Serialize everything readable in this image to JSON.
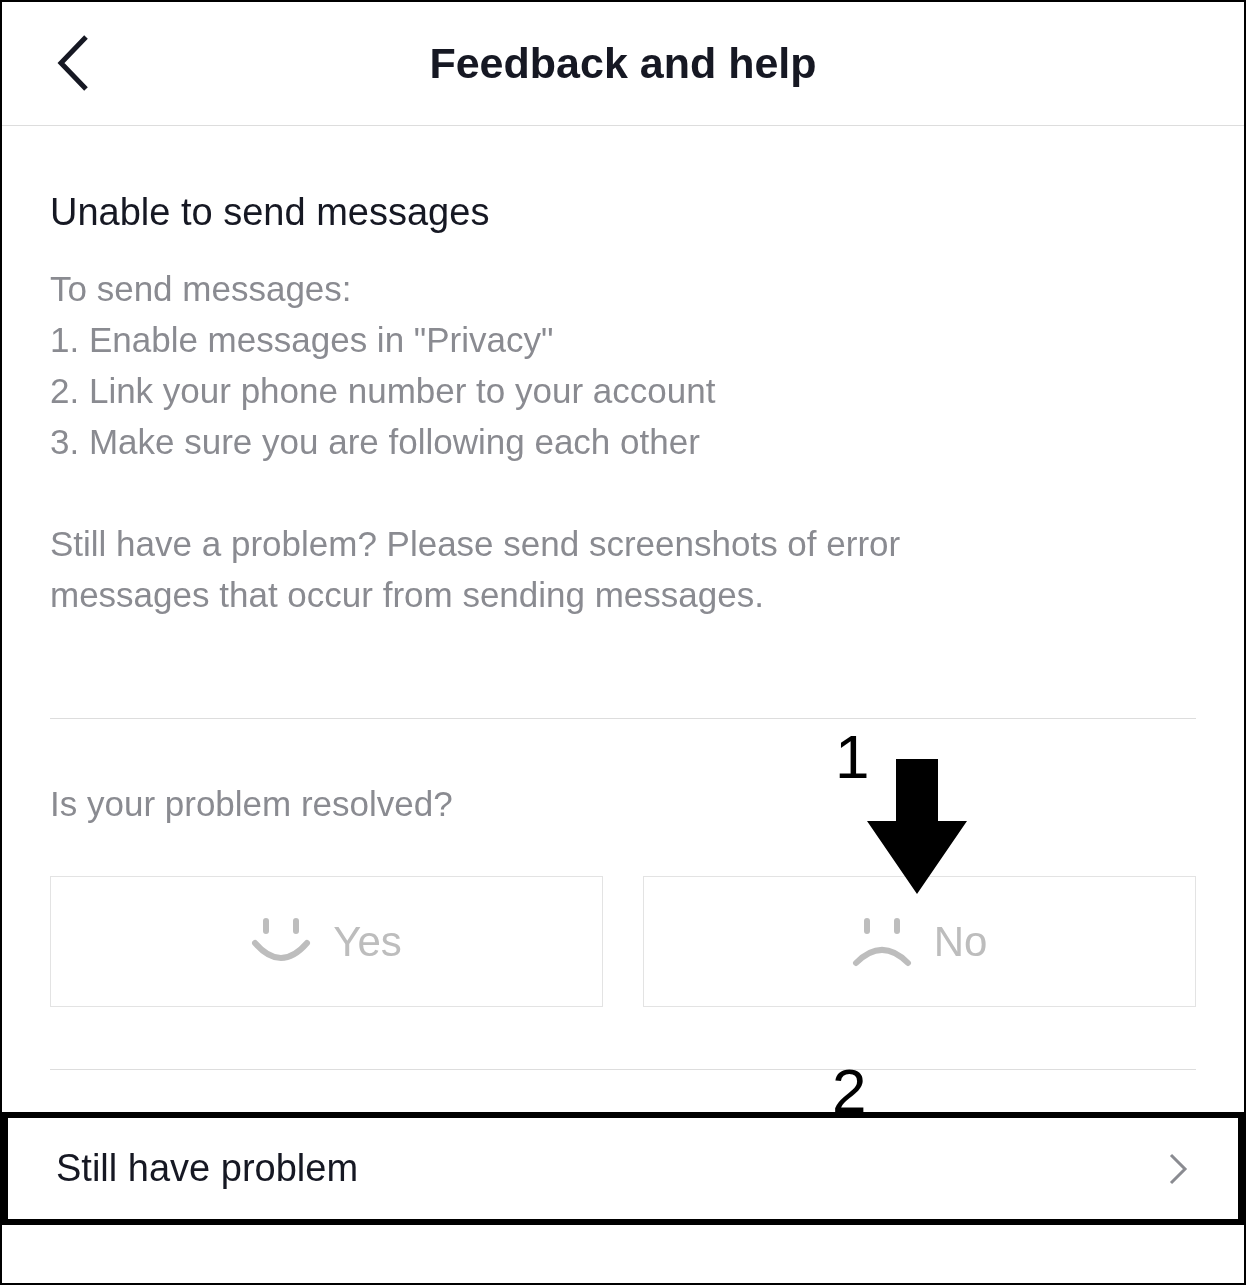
{
  "header": {
    "title": "Feedback and help"
  },
  "article": {
    "title": "Unable to send messages",
    "lines": [
      "To send messages:",
      "1. Enable messages in \"Privacy\"",
      "2. Link your phone number to your account",
      "3. Make sure you are following each other"
    ],
    "paragraph": "Still have a problem? Please send screenshots of error messages that occur from sending messages."
  },
  "feedback": {
    "question": "Is your problem resolved?",
    "options": [
      {
        "label": "Yes",
        "kind": "happy"
      },
      {
        "label": "No",
        "kind": "sad"
      }
    ]
  },
  "link_row": {
    "label": "Still have problem",
    "highlighted": true
  },
  "annotations": [
    {
      "label": "1"
    },
    {
      "label": "2"
    }
  ]
}
